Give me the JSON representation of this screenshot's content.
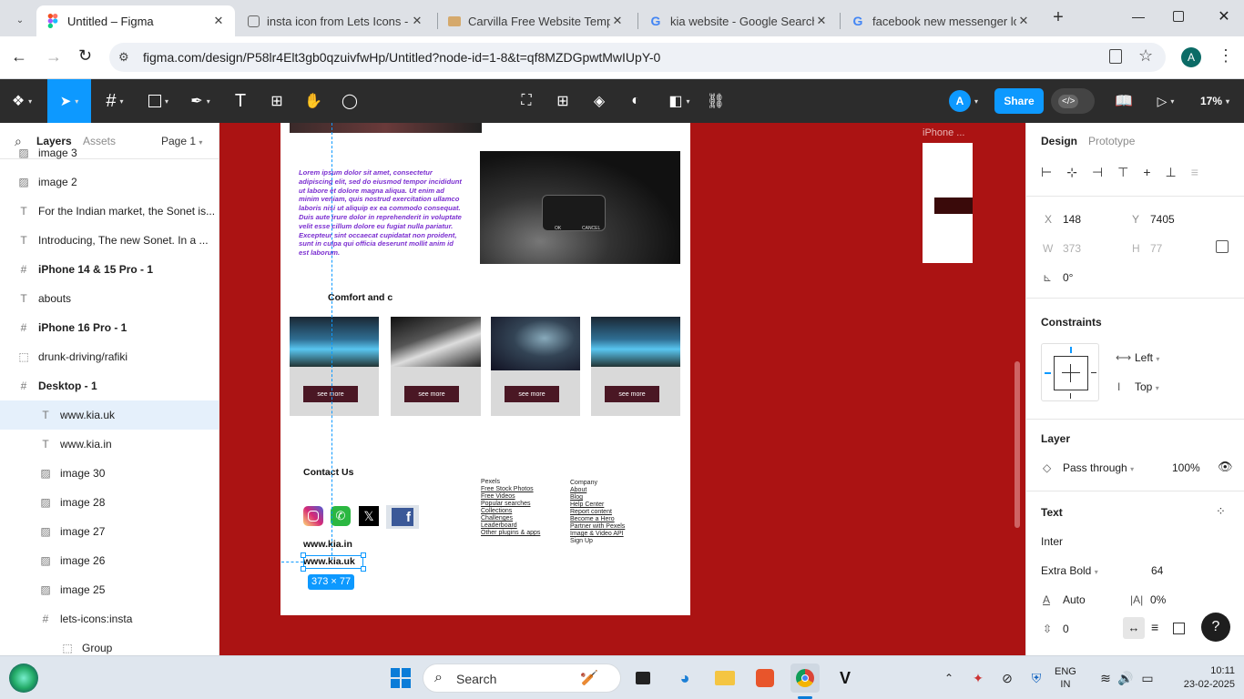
{
  "browser": {
    "tabs": [
      {
        "title": "Untitled – Figma",
        "active": true
      },
      {
        "title": "insta icon from Lets Icons - I",
        "active": false
      },
      {
        "title": "Carvilla Free Website Templa",
        "active": false
      },
      {
        "title": "kia website - Google Search",
        "active": false
      },
      {
        "title": "facebook new messenger lo",
        "active": false
      }
    ],
    "url": "figma.com/design/P58lr4Elt3gb0qzuivfwHp/Untitled?node-id=1-8&t=qf8MZDGpwtMwIUpY-0",
    "profile_initial": "A"
  },
  "figma_toolbar": {
    "user_initial": "A",
    "share_label": "Share",
    "zoom": "17%"
  },
  "layers_panel": {
    "tab_layers": "Layers",
    "tab_assets": "Assets",
    "page": "Page 1",
    "items": [
      {
        "label": "image 3",
        "icon": "image-icon",
        "bold": false,
        "indent": 0
      },
      {
        "label": "image 2",
        "icon": "image-icon",
        "bold": false,
        "indent": 0
      },
      {
        "label": "For the Indian market, the Sonet is...",
        "icon": "text-icon",
        "bold": false,
        "indent": 0
      },
      {
        "label": "Introducing, The new Sonet. In a ...",
        "icon": "text-icon",
        "bold": false,
        "indent": 0
      },
      {
        "label": "iPhone 14 & 15 Pro - 1",
        "icon": "frame-icon",
        "bold": true,
        "indent": 0
      },
      {
        "label": "abouts",
        "icon": "text-icon",
        "bold": false,
        "indent": 0
      },
      {
        "label": "iPhone 16 Pro - 1",
        "icon": "frame-icon",
        "bold": true,
        "indent": 0
      },
      {
        "label": "drunk-driving/rafiki",
        "icon": "dashed-frame-icon",
        "bold": false,
        "indent": 0
      },
      {
        "label": "Desktop - 1",
        "icon": "frame-icon",
        "bold": true,
        "indent": 0
      },
      {
        "label": "www.kia.uk",
        "icon": "text-icon",
        "bold": false,
        "indent": 1,
        "selected": true
      },
      {
        "label": "www.kia.in",
        "icon": "text-icon",
        "bold": false,
        "indent": 1
      },
      {
        "label": "image 30",
        "icon": "image-icon",
        "bold": false,
        "indent": 1
      },
      {
        "label": "image 28",
        "icon": "image-icon",
        "bold": false,
        "indent": 1
      },
      {
        "label": "image 27",
        "icon": "image-icon",
        "bold": false,
        "indent": 1
      },
      {
        "label": "image 26",
        "icon": "image-icon",
        "bold": false,
        "indent": 1
      },
      {
        "label": "image 25",
        "icon": "image-icon",
        "bold": false,
        "indent": 1
      },
      {
        "label": "lets-icons:insta",
        "icon": "frame-icon",
        "bold": false,
        "indent": 1
      },
      {
        "label": "Group",
        "icon": "group-icon",
        "bold": false,
        "indent": 2
      }
    ]
  },
  "canvas": {
    "lorem": "Lorem ipsum dolor sit amet, consectetur adipiscing elit, sed do eiusmod tempor incididunt ut labore et dolore magna aliqua. Ut enim ad minim veniam, quis nostrud exercitation ullamco laboris nisi ut aliquip ex ea commodo consequat. Duis aute irure dolor in reprehenderit in voluptate velit esse cillum dolore eu fugiat nulla pariatur. Excepteur sint occaecat cupidatat non proident, sunt in culpa qui officia deserunt mollit anim id est laborum.",
    "comfort_heading": "Comfort and c",
    "card_button": "see more",
    "steering_buttons": {
      "ok": "OK",
      "cancel": "CANCEL"
    },
    "contact_heading": "Contact Us",
    "site_in": "www.kia.in",
    "site_uk": "www.kia.uk",
    "size_badge": "373 × 77",
    "iphone_label": "iPhone ...",
    "footer_col1": [
      "Pexels",
      "Free Stock Photos",
      "Free Videos",
      "Popular searches",
      "Collections",
      "Challenges",
      "Leaderboard",
      "Other plugins & apps"
    ],
    "footer_col2": [
      "Company",
      "About",
      "Blog",
      "Help Center",
      "Report content",
      "Become a Hero",
      "Partner with Pexels",
      "Image & Video API",
      "Sign Up"
    ]
  },
  "design_panel": {
    "tab_design": "Design",
    "tab_prototype": "Prototype",
    "x_label": "X",
    "x": "148",
    "y_label": "Y",
    "y": "7405",
    "w_label": "W",
    "w": "373",
    "h_label": "H",
    "h": "77",
    "rotation": "0°",
    "constraints_title": "Constraints",
    "constraint_h": "Left",
    "constraint_v": "Top",
    "layer_title": "Layer",
    "blend": "Pass through",
    "opacity": "100%",
    "text_title": "Text",
    "font": "Inter",
    "weight": "Extra Bold",
    "size": "64",
    "line_height": "Auto",
    "letter_spacing": "0%",
    "para_spacing": "0"
  },
  "taskbar": {
    "search_placeholder": "Search",
    "lang_top": "ENG",
    "lang_bottom": "IN",
    "time": "10:11",
    "date": "23-02-2025"
  },
  "colors": {
    "canvas_bg": "#ab1313",
    "share_blue": "#0d99ff",
    "toolbar_dark": "#2c2c2c",
    "lorem_purple": "#7b2fd0",
    "card_button": "#4a1724"
  }
}
